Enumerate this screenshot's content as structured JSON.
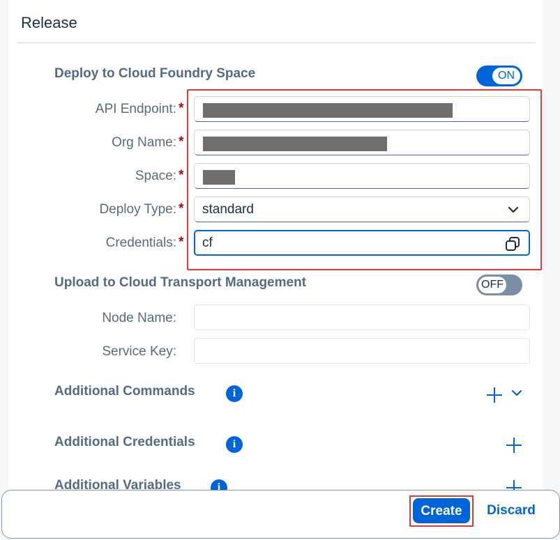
{
  "section": {
    "title": "Release"
  },
  "deploy_cf": {
    "title": "Deploy to Cloud Foundry Space",
    "toggle_label": "ON",
    "fields": [
      {
        "label": "API Endpoint:",
        "value": "",
        "required": "*"
      },
      {
        "label": "Org Name:",
        "value": "",
        "required": "*"
      },
      {
        "label": "Space:",
        "value": "",
        "required": "*"
      },
      {
        "label": "Deploy Type:",
        "value": "standard",
        "required": "*"
      },
      {
        "label": "Credentials:",
        "value": "cf",
        "required": "*"
      }
    ]
  },
  "ctm": {
    "title": "Upload to Cloud Transport Management",
    "toggle_label": "OFF",
    "fields": [
      {
        "label": "Node Name:",
        "value": ""
      },
      {
        "label": "Service Key:",
        "value": ""
      }
    ]
  },
  "additional": [
    {
      "title": "Additional Commands",
      "info_icon": "i"
    },
    {
      "title": "Additional Credentials",
      "info_icon": "i"
    },
    {
      "title": "Additional Variables",
      "info_icon": "i"
    }
  ],
  "footer": {
    "create_label": "Create",
    "discard_label": "Discard"
  },
  "colors": {
    "accent": "#0064d9",
    "highlight": "#e53935",
    "required": "#aa0808"
  },
  "icons": [
    "chevron-down-icon",
    "value-help-icon",
    "info-icon",
    "add-icon"
  ]
}
